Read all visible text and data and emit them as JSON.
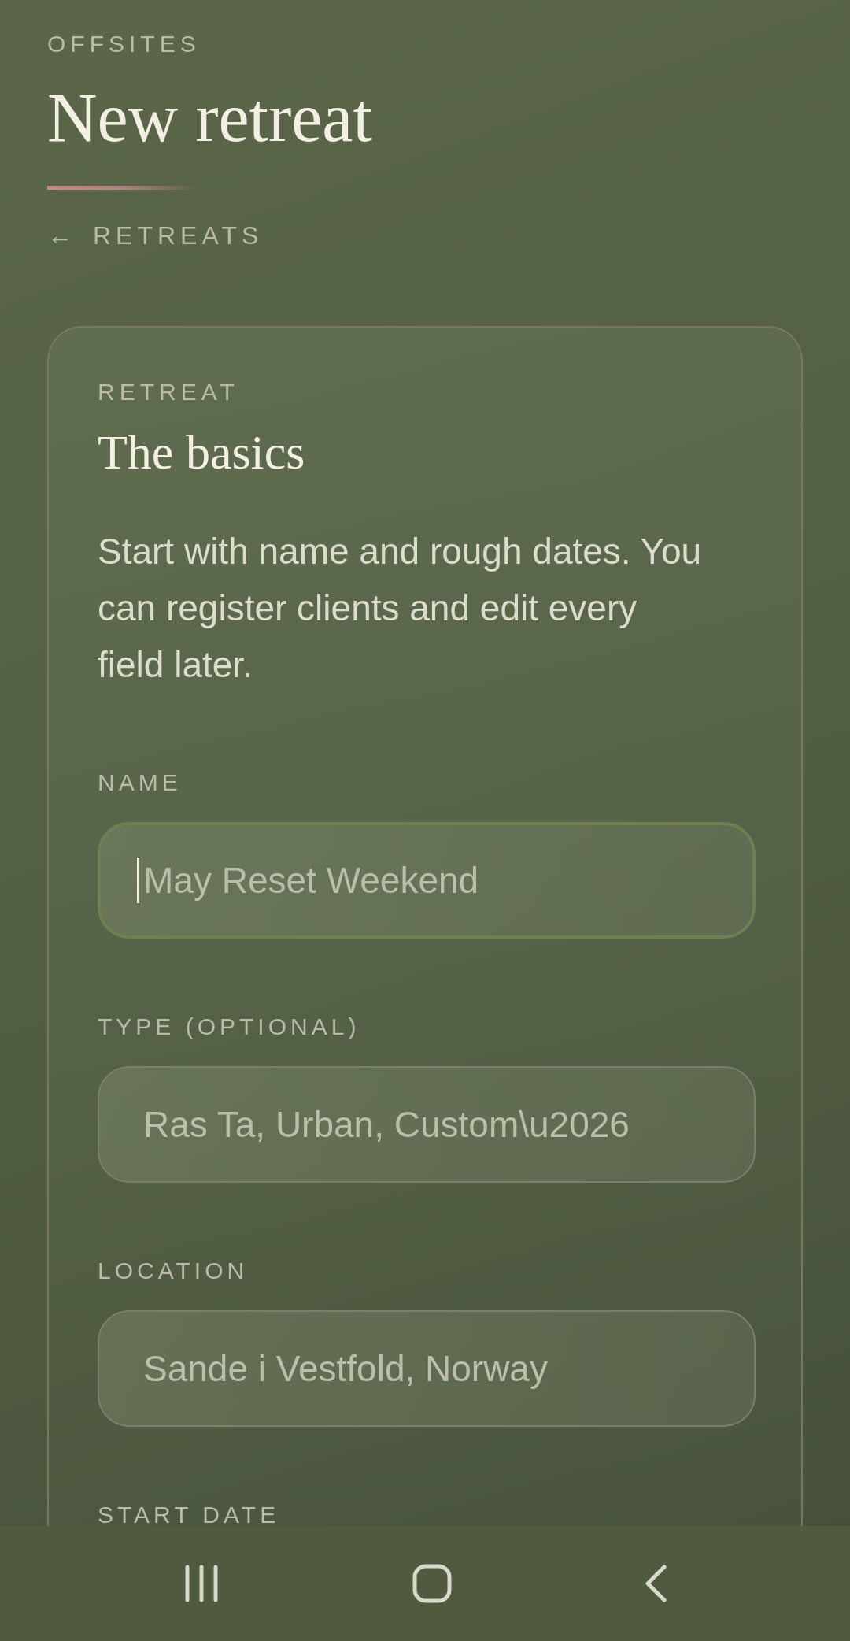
{
  "header": {
    "eyebrow": "OFFSITES",
    "title": "New retreat",
    "back_link": {
      "arrow": "←",
      "label": "RETREATS"
    }
  },
  "card": {
    "eyebrow": "RETREAT",
    "title": "The basics",
    "description": "Start with name and rough dates. You can register clients and edit every field later.",
    "fields": [
      {
        "label": "NAME",
        "placeholder": "May Reset Weekend",
        "focused": true
      },
      {
        "label": "TYPE (OPTIONAL)",
        "placeholder": "Ras Ta, Urban, Custom\\u2026",
        "focused": false
      },
      {
        "label": "LOCATION",
        "placeholder": "Sande i Vestfold, Norway",
        "focused": false
      },
      {
        "label": "START DATE"
      }
    ]
  },
  "nav_bar": {
    "buttons": [
      {
        "kind": "recents"
      },
      {
        "kind": "home"
      },
      {
        "kind": "back"
      }
    ]
  }
}
